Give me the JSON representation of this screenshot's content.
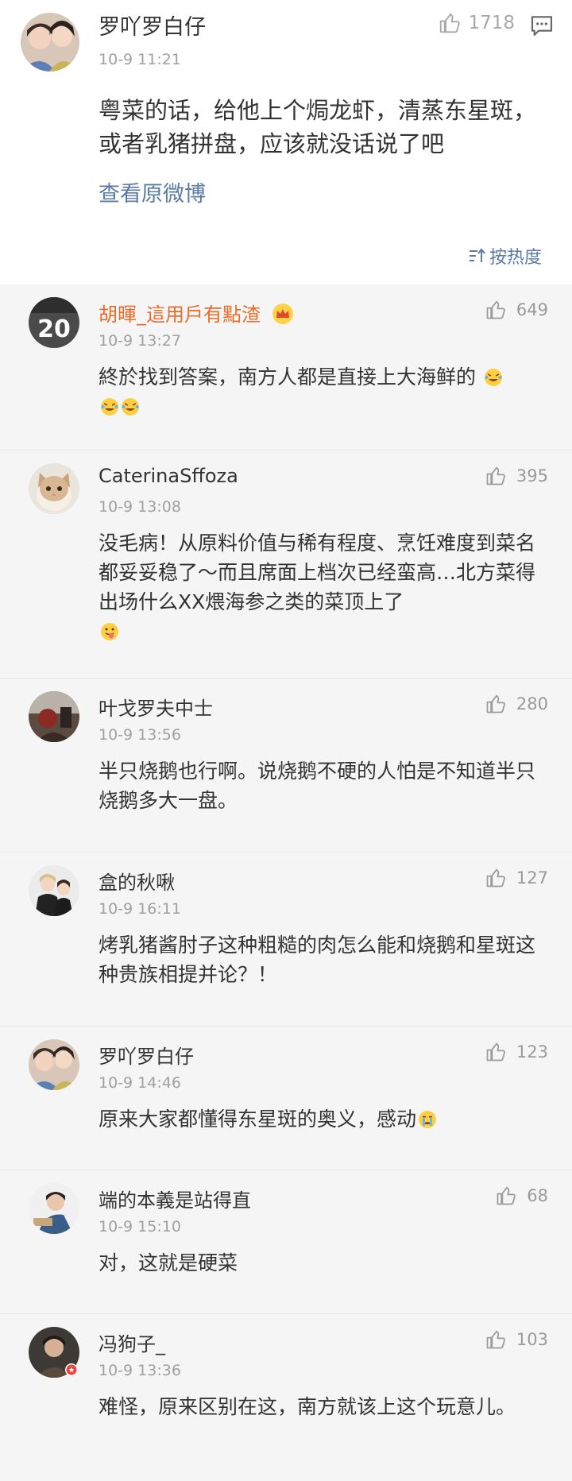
{
  "post": {
    "author": "罗吖罗白仔",
    "time": "10-9 11:21",
    "likes": "1718",
    "text": "粤菜的话，给他上个焗龙虾，清蒸东星斑，或者乳猪拼盘，应该就没话说了吧",
    "view_original": "查看原微博",
    "sort_label": "按热度"
  },
  "comments": [
    {
      "author": "胡暉_這用戶有點渣",
      "time": "10-9 13:27",
      "likes": "649",
      "text": "終於找到答案，南方人都是直接上大海鲜的"
    },
    {
      "author": "CaterinaSffoza",
      "time": "10-9 13:08",
      "likes": "395",
      "text": "没毛病！从原料价值与稀有程度、烹饪难度到菜名都妥妥稳了～而且席面上档次已经蛮高…北方菜得出场什么XX煨海参之类的菜顶上了"
    },
    {
      "author": "叶戈罗夫中士",
      "time": "10-9 13:56",
      "likes": "280",
      "text": "半只烧鹅也行啊。说烧鹅不硬的人怕是不知道半只烧鹅多大一盘。"
    },
    {
      "author": "盒的秋啾",
      "time": "10-9 16:11",
      "likes": "127",
      "text": "烤乳猪酱肘子这种粗糙的肉怎么能和烧鹅和星斑这种贵族相提并论？！"
    },
    {
      "author": "罗吖罗白仔",
      "time": "10-9 14:46",
      "likes": "123",
      "text": "原来大家都懂得东星斑的奥义，感动"
    },
    {
      "author": "端的本義是站得直",
      "time": "10-9 15:10",
      "likes": "68",
      "text": "对，这就是硬菜"
    },
    {
      "author": "冯狗子_",
      "time": "10-9 13:36",
      "likes": "103",
      "text": "难怪，原来区别在这，南方就该上这个玩意儿。"
    }
  ],
  "colors": {
    "link": "#5a7ba6",
    "vip_name": "#e96c2a",
    "list_bg": "#f5f5f5",
    "meta": "#a0a0a0"
  },
  "icons": [
    "thumbs-up-icon",
    "comment-icon",
    "sort-icon",
    "crown-icon",
    "laugh-cry-emoji",
    "tongue-emoji",
    "cry-emoji"
  ]
}
